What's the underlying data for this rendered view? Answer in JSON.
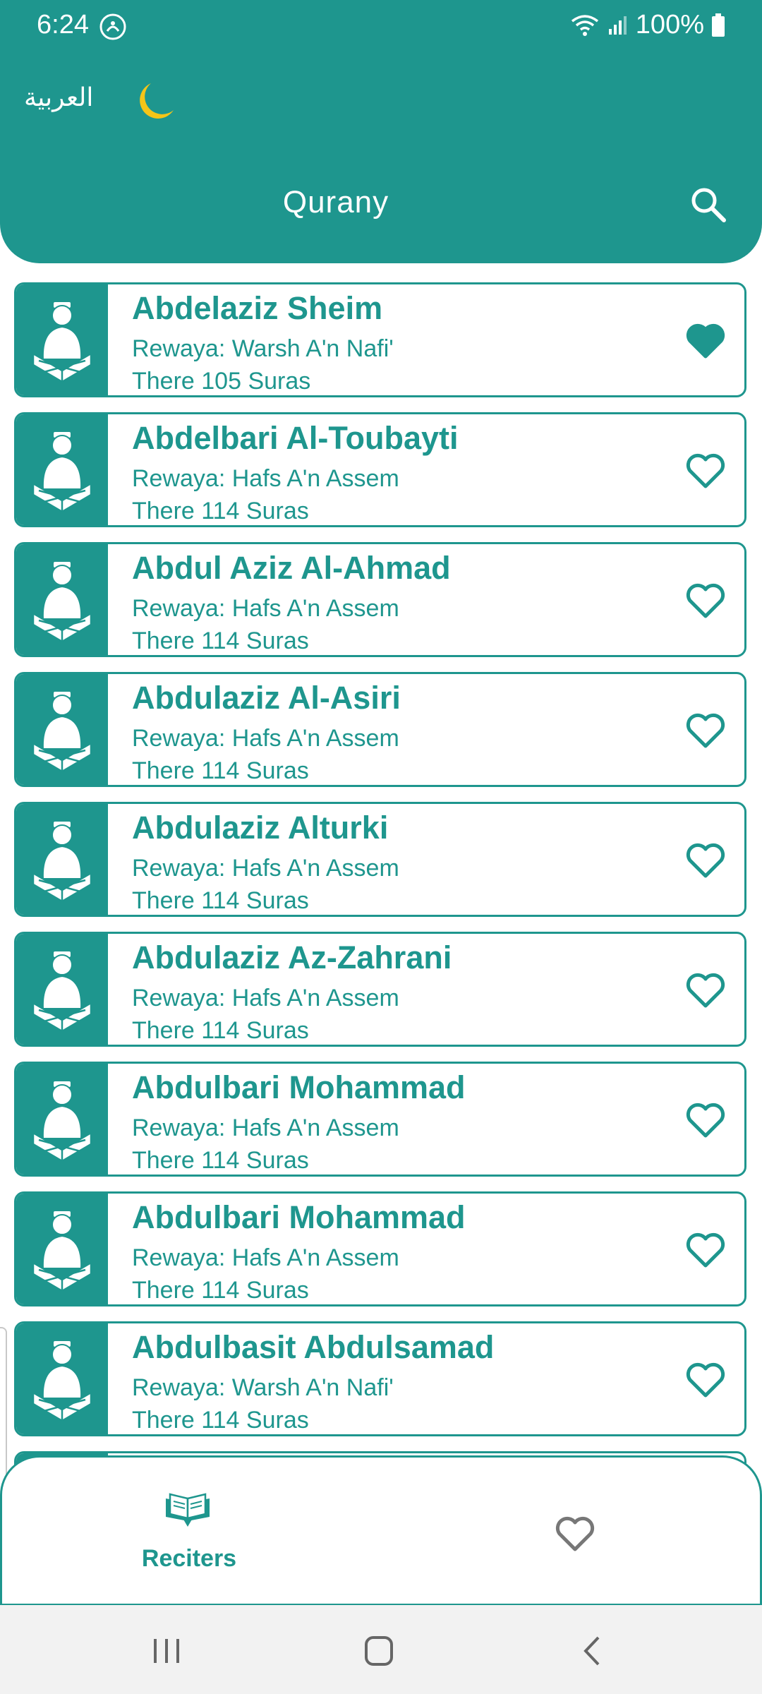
{
  "status_bar": {
    "time": "6:24",
    "battery": "100%"
  },
  "header": {
    "language_toggle": "العربية",
    "title": "Qurany",
    "theme_icon": "crescent-moon-icon",
    "search_icon": "search-icon"
  },
  "colors": {
    "primary": "#1e968e",
    "accent_moon": "#f5c518",
    "background": "#ffffff"
  },
  "reciters": [
    {
      "name": "Abdelaziz Sheim",
      "rewaya": "Rewaya: Warsh A'n Nafi'",
      "suras": "There 105 Suras",
      "favorite": true
    },
    {
      "name": "Abdelbari Al-Toubayti",
      "rewaya": "Rewaya: Hafs A'n Assem",
      "suras": "There 114 Suras",
      "favorite": false
    },
    {
      "name": "Abdul Aziz Al-Ahmad",
      "rewaya": "Rewaya: Hafs A'n Assem",
      "suras": "There 114 Suras",
      "favorite": false
    },
    {
      "name": "Abdulaziz Al-Asiri",
      "rewaya": "Rewaya: Hafs A'n Assem",
      "suras": "There 114 Suras",
      "favorite": false
    },
    {
      "name": "Abdulaziz Alturki",
      "rewaya": "Rewaya: Hafs A'n Assem",
      "suras": "There 114 Suras",
      "favorite": false
    },
    {
      "name": "Abdulaziz Az-Zahrani",
      "rewaya": "Rewaya: Hafs A'n Assem",
      "suras": "There 114 Suras",
      "favorite": false
    },
    {
      "name": "Abdulbari Mohammad",
      "rewaya": "Rewaya: Hafs A'n Assem",
      "suras": "There 114 Suras",
      "favorite": false
    },
    {
      "name": "Abdulbari Mohammad",
      "rewaya": "Rewaya: Hafs A'n Assem",
      "suras": "There 114 Suras",
      "favorite": false
    },
    {
      "name": "Abdulbasit Abdulsamad",
      "rewaya": "Rewaya: Warsh A'n Nafi'",
      "suras": "There 114 Suras",
      "favorite": false
    }
  ],
  "bottom_nav": {
    "reciters_label": "Reciters",
    "reciters_icon": "open-book-icon",
    "favorites_icon": "heart-icon"
  }
}
